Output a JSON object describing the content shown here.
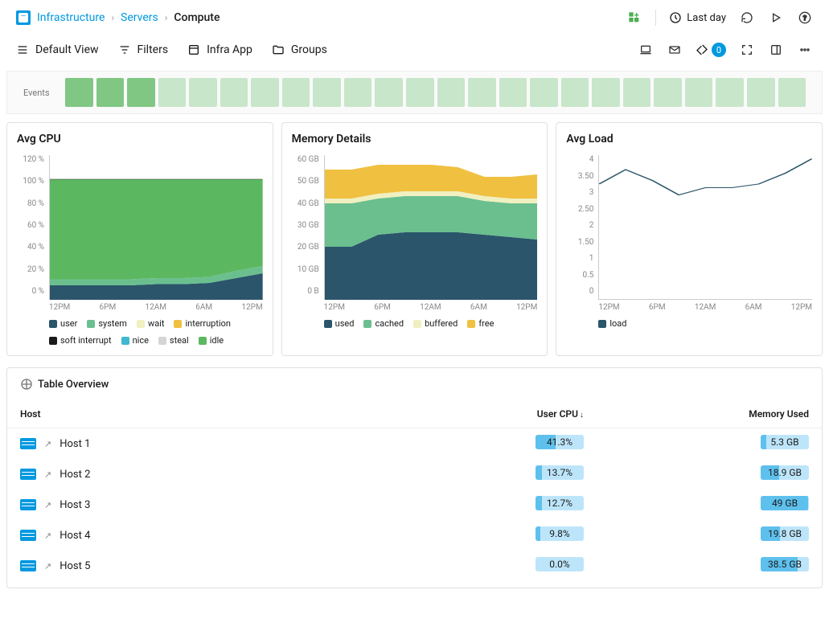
{
  "breadcrumb": {
    "root": "Infrastructure",
    "mid": "Servers",
    "current": "Compute"
  },
  "header": {
    "time_range": "Last day"
  },
  "toolbar": {
    "default_view": "Default View",
    "filters": "Filters",
    "infra_app": "Infra App",
    "groups": "Groups",
    "alert_count": "0"
  },
  "events": {
    "label": "Events",
    "active_indices": [
      0,
      1,
      2
    ]
  },
  "chart_data": [
    {
      "type": "area",
      "title": "Avg CPU",
      "ylabel": "%",
      "ylim": [
        0,
        120
      ],
      "y_ticks": [
        "120 %",
        "100 %",
        "80 %",
        "60 %",
        "40 %",
        "20 %",
        "0 %"
      ],
      "x_ticks": [
        "12PM",
        "6PM",
        "12AM",
        "6AM",
        "12PM"
      ],
      "categories": [
        "12PM",
        "3PM",
        "6PM",
        "9PM",
        "12AM",
        "3AM",
        "6AM",
        "9AM",
        "12PM"
      ],
      "series": [
        {
          "name": "user",
          "color": "#2b556b",
          "values": [
            12,
            12,
            12,
            12,
            13,
            13,
            14,
            18,
            22
          ]
        },
        {
          "name": "system",
          "color": "#6bbf8f",
          "values": [
            5,
            5,
            5,
            5,
            5,
            5,
            5,
            6,
            6
          ]
        },
        {
          "name": "wait",
          "color": "#f0f0c0",
          "values": [
            0,
            0,
            0,
            0,
            0,
            0,
            0,
            0,
            0
          ]
        },
        {
          "name": "interruption",
          "color": "#f0c040",
          "values": [
            0,
            0,
            0,
            0,
            0,
            0,
            0,
            0,
            0
          ]
        },
        {
          "name": "soft interrupt",
          "color": "#1a1a1a",
          "values": [
            0,
            0,
            0,
            0,
            0,
            0,
            0,
            0,
            0
          ]
        },
        {
          "name": "nice",
          "color": "#3fb8d0",
          "values": [
            0,
            0,
            0,
            0,
            0,
            0,
            0,
            0,
            0
          ]
        },
        {
          "name": "steal",
          "color": "#d5d5d5",
          "values": [
            0,
            0,
            0,
            0,
            0,
            0,
            0,
            0,
            0
          ]
        },
        {
          "name": "idle",
          "color": "#5cb860",
          "values": [
            83,
            83,
            83,
            83,
            82,
            82,
            81,
            76,
            72
          ]
        }
      ]
    },
    {
      "type": "area",
      "title": "Memory Details",
      "ylabel": "GB",
      "ylim": [
        0,
        60
      ],
      "y_ticks": [
        "60 GB",
        "50 GB",
        "40 GB",
        "30 GB",
        "20 GB",
        "10 GB",
        "0 B"
      ],
      "x_ticks": [
        "12PM",
        "6PM",
        "12AM",
        "6AM",
        "12PM"
      ],
      "categories": [
        "12PM",
        "3PM",
        "6PM",
        "9PM",
        "12AM",
        "3AM",
        "6AM",
        "9AM",
        "12PM"
      ],
      "series": [
        {
          "name": "used",
          "color": "#2b556b",
          "values": [
            22,
            22,
            27,
            28,
            28,
            28,
            27,
            26,
            25
          ]
        },
        {
          "name": "cached",
          "color": "#6bbf8f",
          "values": [
            18,
            18,
            15,
            15,
            15,
            15,
            14,
            14,
            15
          ]
        },
        {
          "name": "buffered",
          "color": "#f0f0c0",
          "values": [
            2,
            2,
            2,
            2,
            2,
            2,
            2,
            2,
            2
          ]
        },
        {
          "name": "free",
          "color": "#f0c040",
          "values": [
            12,
            12,
            12,
            11,
            11,
            10,
            8,
            9,
            10
          ]
        }
      ]
    },
    {
      "type": "line",
      "title": "Avg Load",
      "ylim": [
        0,
        4
      ],
      "y_ticks": [
        "4",
        "3.50",
        "3",
        "2.50",
        "2",
        "1.50",
        "1",
        "0.5",
        "0"
      ],
      "x_ticks": [
        "12PM",
        "6PM",
        "12AM",
        "6AM",
        "12PM"
      ],
      "categories": [
        "12PM",
        "3PM",
        "6PM",
        "9PM",
        "12AM",
        "3AM",
        "6AM",
        "9AM",
        "12PM"
      ],
      "series": [
        {
          "name": "load",
          "color": "#2b556b",
          "values": [
            3.2,
            3.6,
            3.3,
            2.9,
            3.1,
            3.1,
            3.2,
            3.5,
            3.9
          ]
        }
      ]
    }
  ],
  "table": {
    "title": "Table Overview",
    "columns": {
      "host": "Host",
      "user_cpu": "User CPU",
      "memory_used": "Memory Used"
    },
    "sort_indicator": "↓",
    "rows": [
      {
        "host": "Host 1",
        "user_cpu": "41.3%",
        "user_cpu_pct": 41,
        "memory_used": "5.3 GB",
        "memory_pct": 11
      },
      {
        "host": "Host 2",
        "user_cpu": "13.7%",
        "user_cpu_pct": 14,
        "memory_used": "18.9 GB",
        "memory_pct": 38
      },
      {
        "host": "Host 3",
        "user_cpu": "12.7%",
        "user_cpu_pct": 13,
        "memory_used": "49 GB",
        "memory_pct": 98
      },
      {
        "host": "Host 4",
        "user_cpu": "9.8%",
        "user_cpu_pct": 10,
        "memory_used": "19.8 GB",
        "memory_pct": 40
      },
      {
        "host": "Host 5",
        "user_cpu": "0.0%",
        "user_cpu_pct": 0,
        "memory_used": "38.5 GB",
        "memory_pct": 77
      }
    ]
  }
}
